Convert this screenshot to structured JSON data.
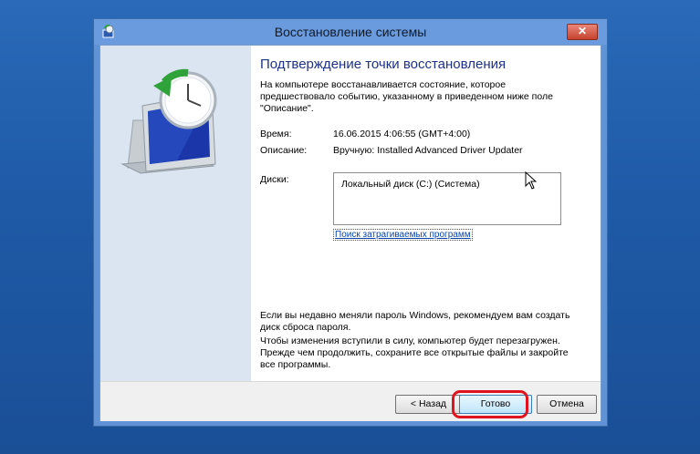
{
  "window": {
    "title": "Восстановление системы",
    "close_symbol": "✕"
  },
  "page": {
    "heading": "Подтверждение точки восстановления",
    "intro": "На компьютере восстанавливается состояние, которое предшествовало событию, указанному в приведенном ниже поле \"Описание\"."
  },
  "details": {
    "time_label": "Время:",
    "time_value": "16.06.2015 4:06:55 (GMT+4:00)",
    "description_label": "Описание:",
    "description_value": "Вручную: Installed Advanced Driver Updater",
    "disks_label": "Диски:",
    "disks": [
      "Локальный диск (C:) (Система)"
    ],
    "affected_programs_link": "Поиск затрагиваемых программ"
  },
  "notes": {
    "password_note": "Если вы недавно меняли пароль Windows, рекомендуем вам создать диск сброса пароля.",
    "restart_note": "Чтобы изменения вступили в силу, компьютер будет перезагружен. Прежде чем продолжить, сохраните все открытые файлы и закройте все программы."
  },
  "footer": {
    "back_label": "< Назад",
    "finish_label": "Готово",
    "cancel_label": "Отмена"
  },
  "icons": {
    "app": "system-restore-icon",
    "illustration": "monitor-clock-restore-icon",
    "cursor": "mouse-pointer-icon"
  },
  "colors": {
    "desktop": "#1e5aa6",
    "titlebar": "#6a9bde",
    "heading": "#1e3287",
    "highlight": "#e0141e",
    "link": "#0645ad"
  }
}
